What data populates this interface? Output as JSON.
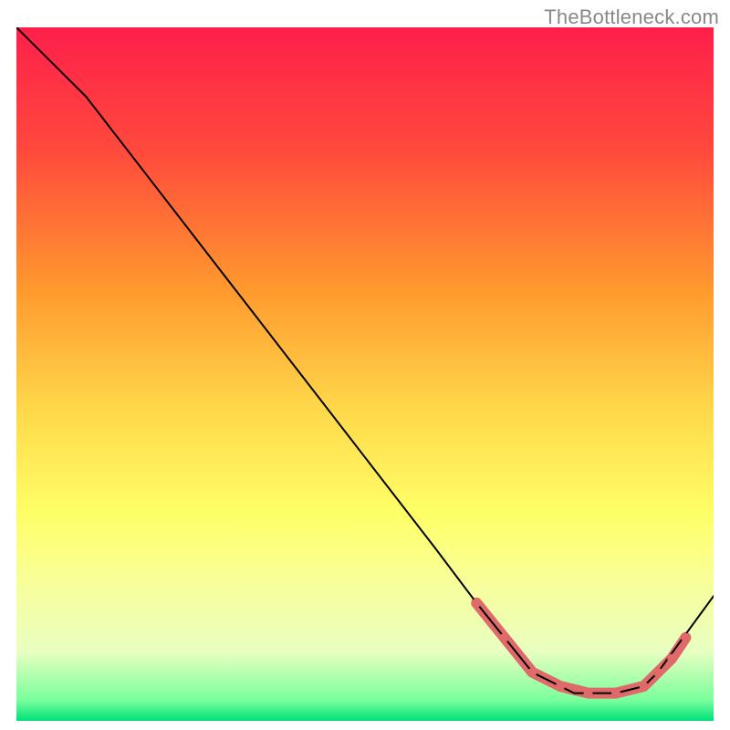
{
  "watermark": "TheBottleneck.com",
  "chart_data": {
    "type": "line",
    "title": "",
    "xlabel": "",
    "ylabel": "",
    "xlim": [
      0,
      100
    ],
    "ylim": [
      0,
      100
    ],
    "gradient_stops": [
      {
        "offset": 0,
        "color": "#ff1f4b"
      },
      {
        "offset": 18,
        "color": "#ff4a3c"
      },
      {
        "offset": 38,
        "color": "#ff9a2e"
      },
      {
        "offset": 55,
        "color": "#ffd84a"
      },
      {
        "offset": 70,
        "color": "#ffff66"
      },
      {
        "offset": 80,
        "color": "#f8ff9a"
      },
      {
        "offset": 90,
        "color": "#e8ffc0"
      },
      {
        "offset": 97,
        "color": "#7aff9c"
      },
      {
        "offset": 100,
        "color": "#00e07a"
      }
    ],
    "series": [
      {
        "name": "bottleneck-curve",
        "x": [
          0,
          6,
          10,
          20,
          30,
          40,
          50,
          60,
          66,
          70,
          74,
          80,
          86,
          90,
          92,
          100
        ],
        "y": [
          100,
          94,
          90,
          77,
          64,
          51,
          38,
          25,
          17,
          12,
          7,
          4,
          4,
          5,
          7,
          18
        ]
      }
    ],
    "markers": {
      "name": "highlight-band",
      "points": [
        {
          "x": 66,
          "y": 17,
          "r": 4
        },
        {
          "x": 70,
          "y": 12,
          "r": 4
        },
        {
          "x": 74,
          "y": 7,
          "r": 4
        },
        {
          "x": 78,
          "y": 5,
          "r": 4
        },
        {
          "x": 82,
          "y": 4,
          "r": 4
        },
        {
          "x": 86,
          "y": 4,
          "r": 4
        },
        {
          "x": 90,
          "y": 5,
          "r": 4
        },
        {
          "x": 92,
          "y": 7,
          "r": 4
        },
        {
          "x": 94,
          "y": 9,
          "r": 4
        },
        {
          "x": 96,
          "y": 12,
          "r": 4
        }
      ],
      "color": "#e06a6a"
    }
  }
}
